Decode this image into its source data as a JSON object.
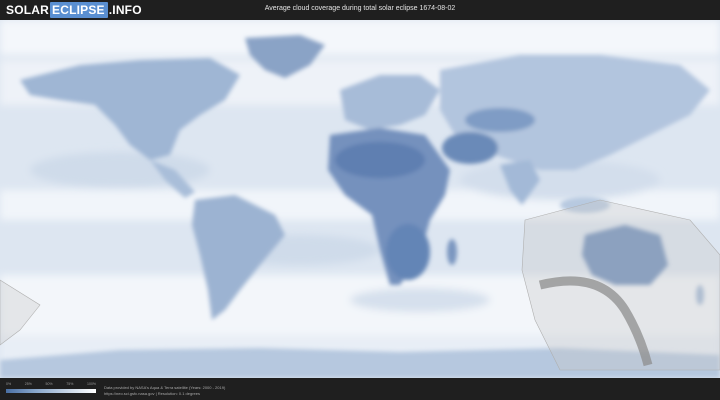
{
  "header": {
    "logo_part1": "SOLAR",
    "logo_part2": "ECLIPSE",
    "logo_part3": ".INFO",
    "title": "Average cloud coverage during total solar eclipse 1674-08-02"
  },
  "legend": {
    "ticks": [
      "0%",
      "25%",
      "50%",
      "75%",
      "100%"
    ],
    "colors": [
      "#4a6fa3",
      "#8aa8cc",
      "#c5d4e6",
      "#ffffff"
    ]
  },
  "footer": {
    "credit_line1": "Data provided by NASA's Aqua & Terra satellite (Years: 2000 - 2019)",
    "credit_line2": "https://neo.sci.gsfc.nasa.gov | Resolution: 0.1 degrees"
  },
  "map": {
    "ocean_color": "#dfe8f2",
    "cloudy_color": "#f4f7fb",
    "clear_land_color": "#5c7fb2",
    "eclipse_band_color": "#c8c8c8"
  }
}
